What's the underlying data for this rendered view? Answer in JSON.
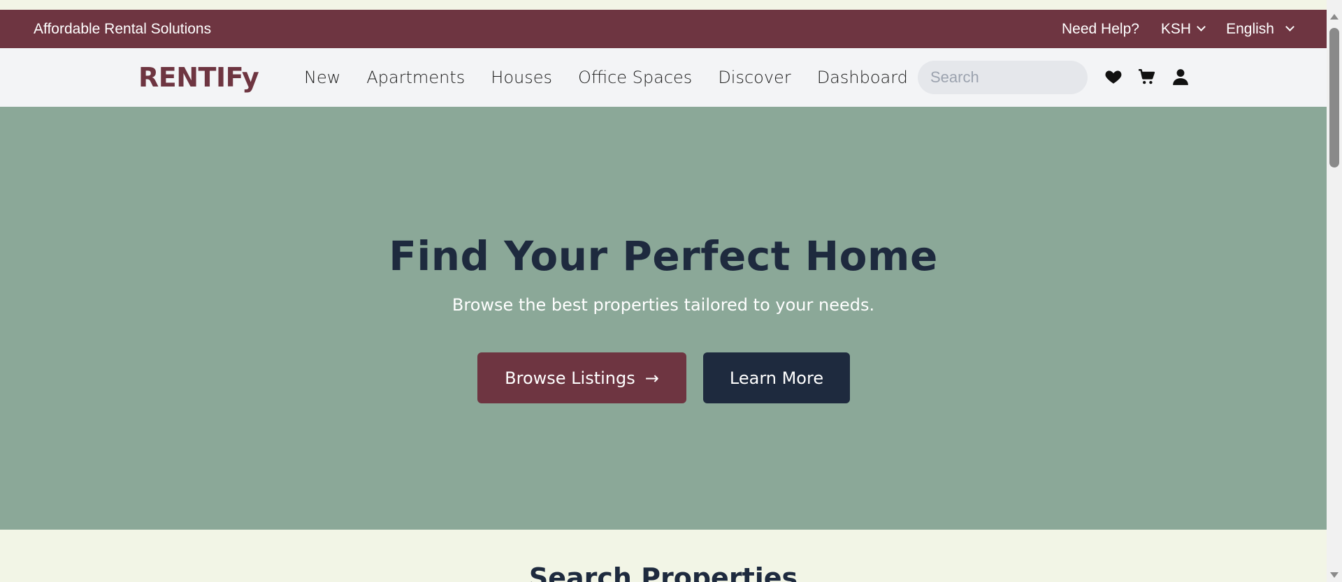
{
  "topbar": {
    "tagline": "Affordable Rental Solutions",
    "help": "Need Help?",
    "currency": "KSH",
    "language": "English"
  },
  "nav": {
    "logo": "RENTIFy",
    "links": [
      "New",
      "Apartments",
      "Houses",
      "Office Spaces",
      "Discover",
      "Dashboard"
    ],
    "search_placeholder": "Search",
    "icons": [
      "heart-icon",
      "cart-icon",
      "user-icon"
    ]
  },
  "hero": {
    "title": "Find Your Perfect Home",
    "subtitle": "Browse the best properties tailored to your needs.",
    "primary_button": "Browse Listings",
    "secondary_button": "Learn More"
  },
  "section": {
    "title": "Search Properties"
  },
  "colors": {
    "brand": "#6e3541",
    "hero_bg": "#8ba898",
    "dark": "#1e2a3e",
    "page_bg": "#f2f5e6"
  }
}
